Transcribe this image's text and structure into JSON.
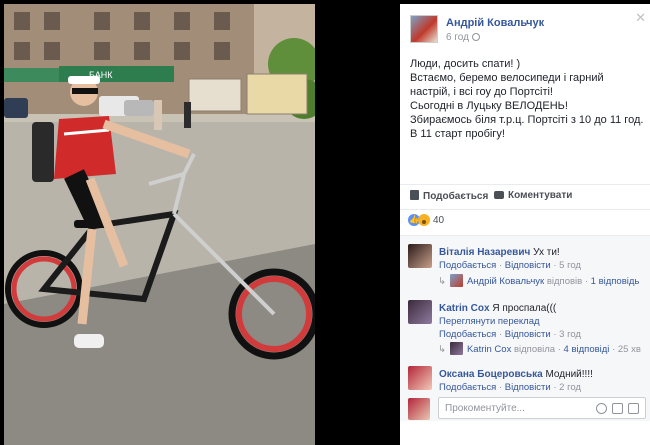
{
  "post": {
    "author": "Андрій Ковальчук",
    "time": "6 год",
    "text_lines": [
      "Люди, досить спати! )",
      "Встаємо, беремо велосипеди і гарний настрій, і всі гоу до Портсіті!",
      "Сьогодні в Луцьку ВЕЛОДЕНЬ!",
      "Збираємось біля т.р.ц. Портсіті з 10 до 11 год.",
      "В 11 старт пробігу!"
    ],
    "like_label": "Подобається",
    "comment_label": "Коментувати",
    "reaction_count": "40"
  },
  "comments": [
    {
      "name": "Віталія Назаревич",
      "text": "Ух ти!",
      "like": "Подобається",
      "reply": "Відповісти",
      "time": "5 год",
      "reply_summary": {
        "author": "Андрій Ковальчук",
        "verb": "відповів",
        "count": "1 відповідь"
      }
    },
    {
      "name": "Katrin Cox",
      "text": "Я проспала(((",
      "see_translation": "Переглянути переклад",
      "like": "Подобається",
      "reply": "Відповісти",
      "time": "3 год",
      "reply_summary": {
        "author": "Katrin Cox",
        "verb": "відповіла",
        "count": "4 відповіді",
        "time": "25 хв"
      }
    },
    {
      "name": "Оксана Боцеровська",
      "text": "Модний!!!!",
      "like": "Подобається",
      "reply": "Відповісти",
      "time": "2 год"
    }
  ],
  "composer": {
    "placeholder": "Прокоментуйте..."
  },
  "photo": {
    "store_sign": "БАНК"
  },
  "colors": {
    "link": "#365899",
    "muted": "#90949c",
    "accent_like": "#5890ff",
    "bike_frame": "#1b1b1b",
    "rims": "#d13b3b"
  }
}
